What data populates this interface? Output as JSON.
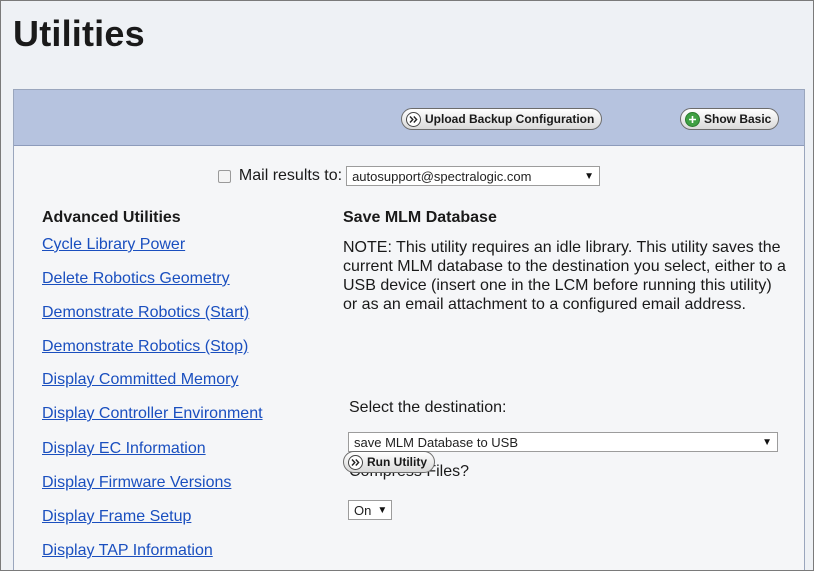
{
  "page": {
    "title": "Utilities"
  },
  "toolbar": {
    "upload_backup_label": "Upload Backup Configuration",
    "show_basic_label": "Show Basic"
  },
  "mail": {
    "label": "Mail results to:",
    "selected": "autosupport@spectralogic.com",
    "checked": false
  },
  "advanced": {
    "heading": "Advanced Utilities",
    "links": [
      "Cycle Library Power",
      "Delete Robotics Geometry",
      "Demonstrate Robotics (Start)",
      "Demonstrate Robotics (Stop)",
      "Display Committed Memory",
      "Display Controller Environment",
      "Display EC Information",
      "Display Firmware Versions",
      "Display Frame Setup",
      "Display TAP Information"
    ]
  },
  "detail": {
    "heading": "Save MLM Database",
    "note": "NOTE: This utility requires an idle library. This utility saves the current MLM database to the destination you select, either to a USB device (insert one in the LCM before running this utility) or as an email attachment to a configured email address.",
    "destination_label": "Select the destination:",
    "destination_selected": "save MLM Database to USB",
    "compress_label": "Compress Files?",
    "compress_selected": "On",
    "run_label": "Run Utility"
  },
  "icons": {
    "chevron": "double-chevron-right-icon",
    "plus": "plus-icon"
  },
  "colors": {
    "toolbar_bg": "#b6c3df",
    "link": "#1a4fbf",
    "plus_green": "#3fa043"
  }
}
